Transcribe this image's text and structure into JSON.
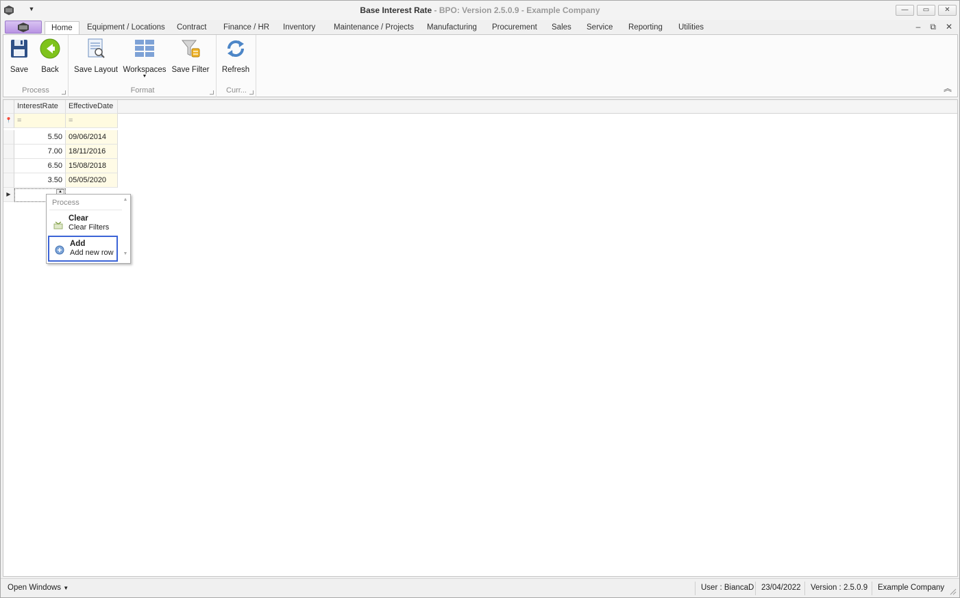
{
  "window": {
    "title_main": "Base Interest Rate",
    "title_sub": "- BPO: Version 2.5.0.9 - Example Company"
  },
  "tabs": [
    {
      "label": "Home",
      "active": true
    },
    {
      "label": "Equipment / Locations"
    },
    {
      "label": "Contract"
    },
    {
      "label": "Finance / HR"
    },
    {
      "label": "Inventory"
    },
    {
      "label": "Maintenance / Projects"
    },
    {
      "label": "Manufacturing"
    },
    {
      "label": "Procurement"
    },
    {
      "label": "Sales"
    },
    {
      "label": "Service"
    },
    {
      "label": "Reporting"
    },
    {
      "label": "Utilities"
    }
  ],
  "ribbon": {
    "groups": {
      "process": "Process",
      "format": "Format",
      "current": "Curr..."
    },
    "buttons": {
      "save": "Save",
      "back": "Back",
      "save_layout": "Save Layout",
      "workspaces": "Workspaces",
      "save_filter": "Save Filter",
      "refresh": "Refresh"
    }
  },
  "grid": {
    "columns": [
      "InterestRate",
      "EffectiveDate"
    ],
    "filter_symbol": "=",
    "rows": [
      {
        "rate": "5.50",
        "date": "09/06/2014"
      },
      {
        "rate": "7.00",
        "date": "18/11/2016"
      },
      {
        "rate": "6.50",
        "date": "15/08/2018"
      },
      {
        "rate": "3.50",
        "date": "05/05/2020"
      }
    ]
  },
  "popup": {
    "group_label": "Process",
    "items": [
      {
        "title": "Clear",
        "desc": "Clear Filters"
      },
      {
        "title": "Add",
        "desc": "Add new row",
        "selected": true
      }
    ]
  },
  "status": {
    "open_windows": "Open Windows",
    "user": "User : BiancaD",
    "date": "23/04/2022",
    "version": "Version : 2.5.0.9",
    "company": "Example Company"
  },
  "colors": {
    "selection_border": "#3b63d6",
    "filter_bg": "#fffbe0",
    "file_button": "#b893e3"
  }
}
